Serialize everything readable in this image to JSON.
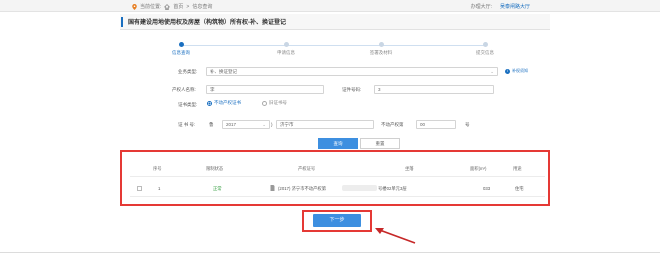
{
  "topbar": {
    "location_label": "当前位置:",
    "home": "首页",
    "separator": ">",
    "current": "信息查询",
    "service_label": "办理大厅:",
    "service_hall": "吴泰闸路大厅"
  },
  "page": {
    "title": "国有建设用地使用权及房屋（构筑物）所有权-补、换证登记"
  },
  "steps": [
    {
      "label": "信息查询",
      "active": true
    },
    {
      "label": "申请信息",
      "active": false
    },
    {
      "label": "签署及材料",
      "active": false
    },
    {
      "label": "提交信息",
      "active": false
    }
  ],
  "form": {
    "business_type_label": "业务类型:",
    "business_type_value": "补、换证登记",
    "info_link": "补权须知",
    "owner_label": "产权人名称:",
    "owner_value": "李",
    "cert_no_label": "证件号码:",
    "cert_no_value": "3",
    "cert_type_label": "证书类型:",
    "cert_type_options": [
      "不动产权证书",
      "旧证书号"
    ],
    "cert_no2_label": "证 书 号:",
    "prefix": "鲁",
    "year": "2017",
    "city": "济宁市",
    "num_label": "不动产权第",
    "num_value": "00",
    "suffix": "号"
  },
  "buttons": {
    "query": "查询",
    "reset": "重置",
    "next": "下一步"
  },
  "table": {
    "headers": [
      "序号",
      "限制状态",
      "产权证号",
      "坐落",
      "面积(m²)",
      "用途"
    ],
    "rows": [
      {
        "index": "1",
        "status": "正常",
        "cert": "(2017) 济宁市不动产权第",
        "location": "号楼02单元3层",
        "area": "033",
        "use": "住宅"
      }
    ]
  }
}
